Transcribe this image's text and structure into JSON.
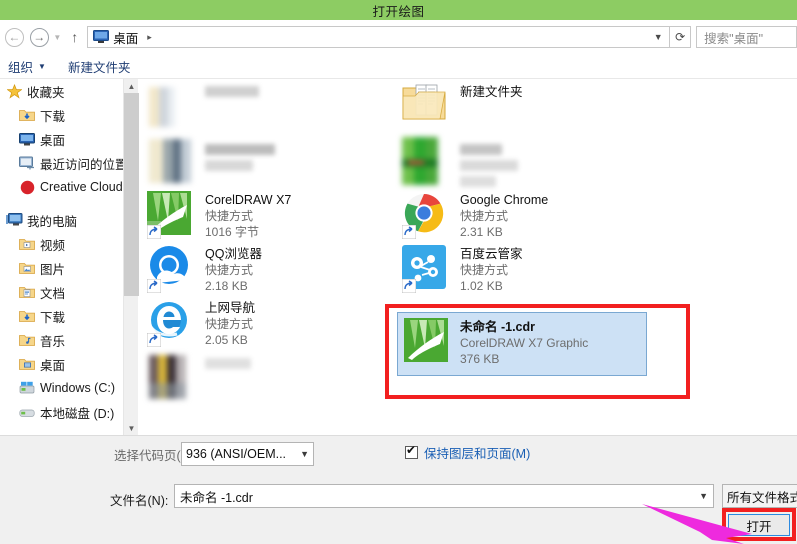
{
  "window": {
    "title": "打开绘图",
    "title_bar_color": "#8dcc63"
  },
  "nav": {
    "back_icon": "back-arrow-icon",
    "forward_icon": "forward-arrow-icon",
    "history_icon": "chevron-down-icon",
    "up_icon": "up-arrow-icon",
    "refresh_icon": "refresh-icon",
    "address": {
      "icon": "desktop-icon",
      "crumb": "桌面",
      "separator": "▸",
      "dropdown_icon": "chevron-down-icon"
    },
    "search": {
      "placeholder": "搜索\"桌面\"",
      "value": "搜索\"桌面\""
    }
  },
  "toolbar": {
    "organize_label": "组织",
    "organize_caret": "▼",
    "new_folder_label": "新建文件夹"
  },
  "sidebar": {
    "groups": [
      {
        "header": {
          "label": "收藏夹",
          "icon": "star-icon"
        },
        "items": [
          {
            "label": "下载",
            "icon": "download-folder-icon"
          },
          {
            "label": "桌面",
            "icon": "desktop-icon"
          },
          {
            "label": "最近访问的位置",
            "icon": "recent-places-icon"
          },
          {
            "label": "Creative Cloud",
            "icon": "creative-cloud-icon"
          }
        ]
      },
      {
        "header": {
          "label": "我的电脑",
          "icon": "computer-icon"
        },
        "items": [
          {
            "label": "视频",
            "icon": "video-folder-icon"
          },
          {
            "label": "图片",
            "icon": "pictures-folder-icon"
          },
          {
            "label": "文档",
            "icon": "documents-folder-icon"
          },
          {
            "label": "下载",
            "icon": "download-folder-icon"
          },
          {
            "label": "音乐",
            "icon": "music-folder-icon"
          },
          {
            "label": "桌面",
            "icon": "desktop-folder-icon"
          },
          {
            "label": "Windows (C:)",
            "icon": "system-drive-icon"
          },
          {
            "label": "本地磁盘 (D:)",
            "icon": "drive-icon"
          }
        ]
      }
    ],
    "scrollbar": {
      "up_icon": "scroll-up-icon",
      "down_icon": "scroll-down-icon"
    }
  },
  "filelist": {
    "left_column": [
      {
        "blurred": true,
        "icon": "blurred-file-icon",
        "name": "",
        "type": "",
        "size": ""
      },
      {
        "blurred": true,
        "icon": "blurred-file-icon",
        "name": "",
        "type": "",
        "size": ""
      },
      {
        "blurred": false,
        "icon": "coreldraw-icon",
        "name": "CorelDRAW X7",
        "type": "快捷方式",
        "size": "1016 字节"
      },
      {
        "blurred": false,
        "icon": "qq-browser-icon",
        "name": "QQ浏览器",
        "type": "快捷方式",
        "size": "2.18 KB"
      },
      {
        "blurred": false,
        "icon": "ie-icon",
        "name": "上网导航",
        "type": "快捷方式",
        "size": "2.05 KB"
      },
      {
        "blurred": true,
        "icon": "blurred-file-icon",
        "name": "",
        "type": "",
        "size": ""
      }
    ],
    "right_column": [
      {
        "blurred": false,
        "icon": "folder-icon",
        "name": "新建文件夹",
        "type": "",
        "size": ""
      },
      {
        "blurred": true,
        "icon": "blurred-file-icon",
        "name": "",
        "type": "",
        "size": ""
      },
      {
        "blurred": false,
        "icon": "chrome-icon",
        "name": "Google Chrome",
        "type": "快捷方式",
        "size": "2.31 KB"
      },
      {
        "blurred": false,
        "icon": "baidu-cloud-icon",
        "name": "百度云管家",
        "type": "快捷方式",
        "size": "1.02 KB"
      }
    ],
    "selected_file": {
      "icon": "coreldraw-icon",
      "name": "未命名 -1.cdr",
      "type": "CorelDRAW X7 Graphic",
      "size": "376 KB"
    }
  },
  "annotations": {
    "box_color": "#f22020",
    "arrow_color": "#ee2ade",
    "selected_file_box": "red-highlight-box",
    "open_button_box": "red-highlight-box",
    "pointer": "magenta-arrow"
  },
  "bottom": {
    "codepage_label": "选择代码页(G)",
    "codepage_value": "936   (ANSI/OEM...",
    "codepage_arrow": "▼",
    "keep_layers_label": "保持图层和页面(M)",
    "keep_layers_checked": true,
    "filename_label": "文件名(N):",
    "filename_value": "未命名 -1.cdr",
    "filename_arrow": "▼",
    "filetype_value": "所有文件格式",
    "open_button_label": "打开"
  }
}
